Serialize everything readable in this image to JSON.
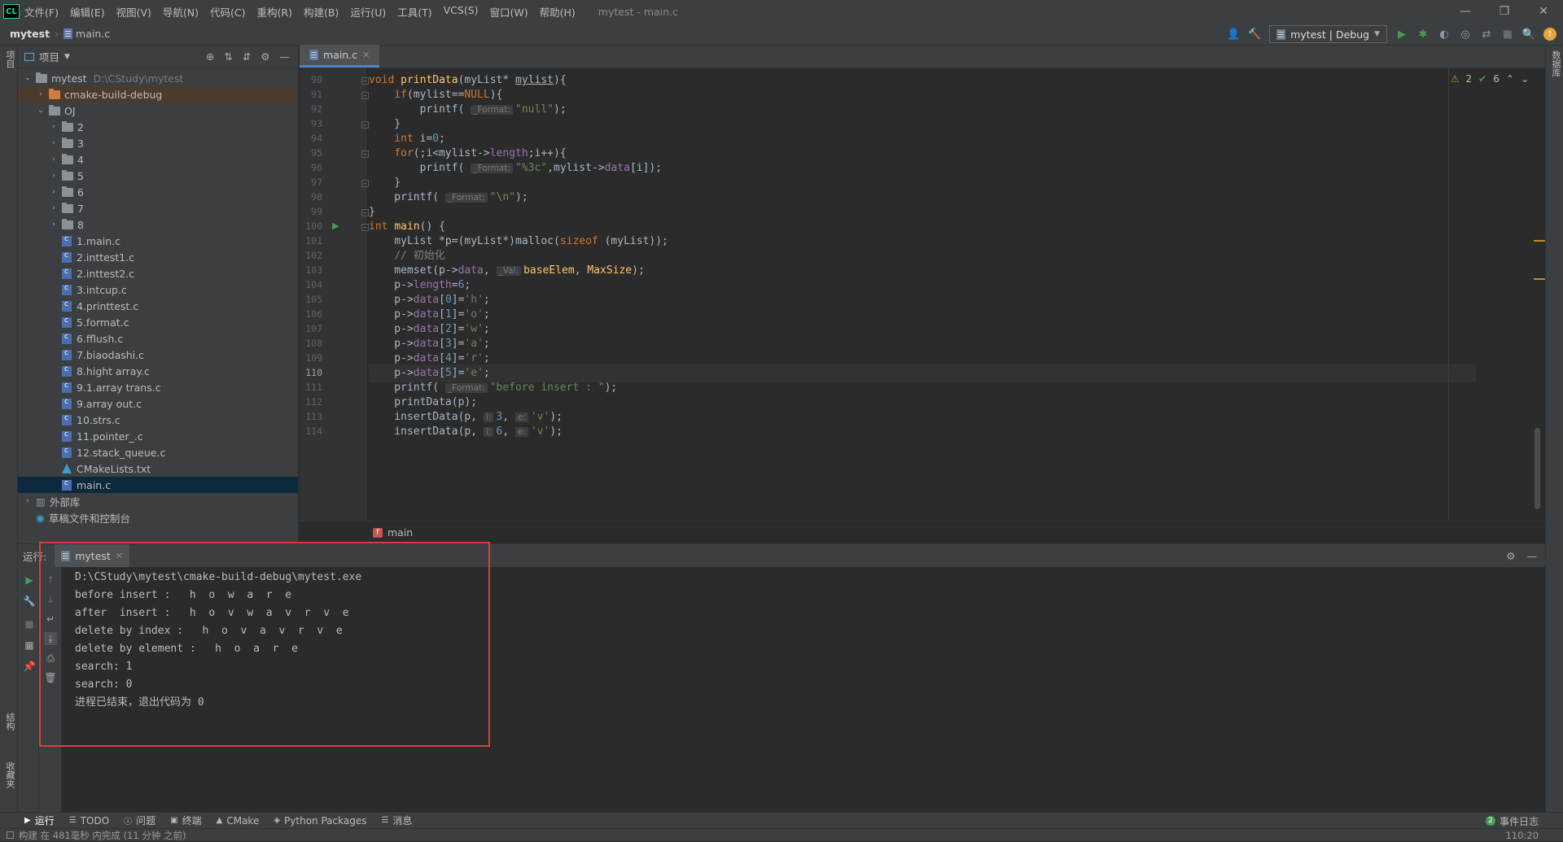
{
  "app": {
    "logo": "CL",
    "window_title": "mytest - main.c"
  },
  "menu": [
    "文件(F)",
    "编辑(E)",
    "视图(V)",
    "导航(N)",
    "代码(C)",
    "重构(R)",
    "构建(B)",
    "运行(U)",
    "工具(T)",
    "VCS(S)",
    "窗口(W)",
    "帮助(H)"
  ],
  "window_controls": {
    "minimize": "—",
    "restore": "❐",
    "close": "✕"
  },
  "nav": {
    "project": "mytest",
    "file": "main.c"
  },
  "toolbar": {
    "run_config": "mytest | Debug"
  },
  "left_strip": {
    "project": "项目",
    "structure": "结构",
    "favorites": "收藏夹"
  },
  "right_strip": {
    "database": "数据库"
  },
  "project_panel": {
    "title": "项目",
    "tree": [
      {
        "label": "mytest",
        "extra": "D:\\CStudy\\mytest",
        "kind": "folder",
        "depth": 0,
        "open": true
      },
      {
        "label": "cmake-build-debug",
        "kind": "folder-orange",
        "depth": 1,
        "open": false
      },
      {
        "label": "OJ",
        "kind": "folder",
        "depth": 1,
        "open": true
      },
      {
        "label": "2",
        "kind": "folder",
        "depth": 2,
        "open": false
      },
      {
        "label": "3",
        "kind": "folder",
        "depth": 2,
        "open": false
      },
      {
        "label": "4",
        "kind": "folder",
        "depth": 2,
        "open": false
      },
      {
        "label": "5",
        "kind": "folder",
        "depth": 2,
        "open": false
      },
      {
        "label": "6",
        "kind": "folder",
        "depth": 2,
        "open": false
      },
      {
        "label": "7",
        "kind": "folder",
        "depth": 2,
        "open": false
      },
      {
        "label": "8",
        "kind": "folder",
        "depth": 2,
        "open": false
      },
      {
        "label": "1.main.c",
        "kind": "c",
        "depth": 2
      },
      {
        "label": "2.inttest1.c",
        "kind": "c",
        "depth": 2
      },
      {
        "label": "2.inttest2.c",
        "kind": "c",
        "depth": 2
      },
      {
        "label": "3.intcup.c",
        "kind": "c",
        "depth": 2
      },
      {
        "label": "4.printtest.c",
        "kind": "c",
        "depth": 2
      },
      {
        "label": "5.format.c",
        "kind": "c",
        "depth": 2
      },
      {
        "label": "6.fflush.c",
        "kind": "c",
        "depth": 2
      },
      {
        "label": "7.biaodashi.c",
        "kind": "c",
        "depth": 2
      },
      {
        "label": "8.hight array.c",
        "kind": "c",
        "depth": 2
      },
      {
        "label": "9.1.array trans.c",
        "kind": "c",
        "depth": 2
      },
      {
        "label": "9.array out.c",
        "kind": "c",
        "depth": 2
      },
      {
        "label": "10.strs.c",
        "kind": "c",
        "depth": 2
      },
      {
        "label": "11.pointer_.c",
        "kind": "c",
        "depth": 2
      },
      {
        "label": "12.stack_queue.c",
        "kind": "c",
        "depth": 2
      },
      {
        "label": "CMakeLists.txt",
        "kind": "cmake",
        "depth": 2
      },
      {
        "label": "main.c",
        "kind": "c",
        "depth": 2,
        "selected": true
      },
      {
        "label": "外部库",
        "kind": "lib",
        "depth": 0,
        "open": false
      },
      {
        "label": "草稿文件和控制台",
        "kind": "scratch",
        "depth": 0
      }
    ]
  },
  "editor": {
    "tab": "main.c",
    "inspections": {
      "warnings": "2",
      "ok": "6"
    },
    "current_line": 110,
    "lines": [
      {
        "n": 90,
        "html": "<span class='kw'>void</span> <span class='fn'>printData</span>(myList* <u>mylist</u>){"
      },
      {
        "n": 91,
        "html": "    <span class='kw'>if</span>(mylist==<span class='kw'>NULL</span>){"
      },
      {
        "n": 92,
        "html": "        printf( <span class='hint'>_Format:</span><span class='str'>\"null\"</span>);"
      },
      {
        "n": 93,
        "html": "    }"
      },
      {
        "n": 94,
        "html": "    <span class='kw'>int</span> i=<span class='num'>0</span>;"
      },
      {
        "n": 95,
        "html": "    <span class='kw'>for</span>(;i&lt;mylist-&gt;<span class='fld'>length</span>;i++){"
      },
      {
        "n": 96,
        "html": "        printf( <span class='hint'>_Format:</span><span class='str'>\"%3c\"</span>,mylist-&gt;<span class='fld'>data</span>[i]);"
      },
      {
        "n": 97,
        "html": "    }"
      },
      {
        "n": 98,
        "html": "    printf( <span class='hint'>_Format:</span><span class='str'>\"\\n\"</span>);"
      },
      {
        "n": 99,
        "html": "}"
      },
      {
        "n": 100,
        "html": "<span class='kw'>int</span> <span class='fn'>main</span>() {"
      },
      {
        "n": 101,
        "html": "    myList *p=(myList*)malloc(<span class='kw'>sizeof</span> (myList));"
      },
      {
        "n": 102,
        "html": "    <span class='cmt'>// 初始化</span>"
      },
      {
        "n": 103,
        "html": "    memset(p-&gt;<span class='fld'>data</span>, <span class='hint'>_Val:</span><span class='fn'>baseElem</span>, <span class='fn'>MaxSize</span>);"
      },
      {
        "n": 104,
        "html": "    p-&gt;<span class='fld'>length</span>=<span class='num'>6</span>;"
      },
      {
        "n": 105,
        "html": "    p-&gt;<span class='fld'>data</span>[<span class='num'>0</span>]=<span class='str'>'h'</span>;"
      },
      {
        "n": 106,
        "html": "    p-&gt;<span class='fld'>data</span>[<span class='num'>1</span>]=<span class='str'>'o'</span>;"
      },
      {
        "n": 107,
        "html": "    p-&gt;<span class='fld'>data</span>[<span class='num'>2</span>]=<span class='str'>'w'</span>;"
      },
      {
        "n": 108,
        "html": "    p-&gt;<span class='fld'>data</span>[<span class='num'>3</span>]=<span class='str'>'a'</span>;"
      },
      {
        "n": 109,
        "html": "    p-&gt;<span class='fld'>data</span>[<span class='num'>4</span>]=<span class='str'>'r'</span>;"
      },
      {
        "n": 110,
        "html": "    p-&gt;<span class='fld'>data</span>[<span class='num'>5</span>]=<span class='str'>'e'</span>;"
      },
      {
        "n": 111,
        "html": "    printf( <span class='hint'>_Format:</span><span class='str'>\"before insert : \"</span>);"
      },
      {
        "n": 112,
        "html": "    printData(p);"
      },
      {
        "n": 113,
        "html": "    insertData(p, <span class='hint'>i:</span><span class='num'>3</span>, <span class='hint'>e:</span><span class='str'>'v'</span>);"
      },
      {
        "n": 114,
        "html": "    insertData(p, <span class='hint'>i:</span><span class='num'>6</span>, <span class='hint'>e:</span><span class='str'>'v'</span>);"
      }
    ],
    "breadcrumb": {
      "badge": "f",
      "fn": "main"
    }
  },
  "run_panel": {
    "label": "运行:",
    "tab": "mytest",
    "output": [
      "D:\\CStudy\\mytest\\cmake-build-debug\\mytest.exe",
      "before insert :   h  o  w  a  r  e",
      "after  insert :   h  o  v  w  a  v  r  v  e",
      "delete by index :   h  o  v  a  v  r  v  e",
      "delete by element :   h  o  a  r  e",
      "search: 1",
      "search: 0",
      "进程已结束，退出代码为 0"
    ]
  },
  "bottom_tabs": [
    "运行",
    "TODO",
    "问题",
    "终端",
    "CMake",
    "Python Packages",
    "消息"
  ],
  "event_log": {
    "count": "2",
    "label": "事件日志"
  },
  "status": {
    "message": "构建 在 481毫秒 内完成 (11 分钟 之前)",
    "position": "110:20"
  },
  "colors": {
    "keyword": "#cc7832",
    "function": "#ffc66d",
    "string": "#6a8759",
    "number": "#6897bb",
    "field": "#9876aa",
    "highlight_box": "#e03c3c"
  }
}
